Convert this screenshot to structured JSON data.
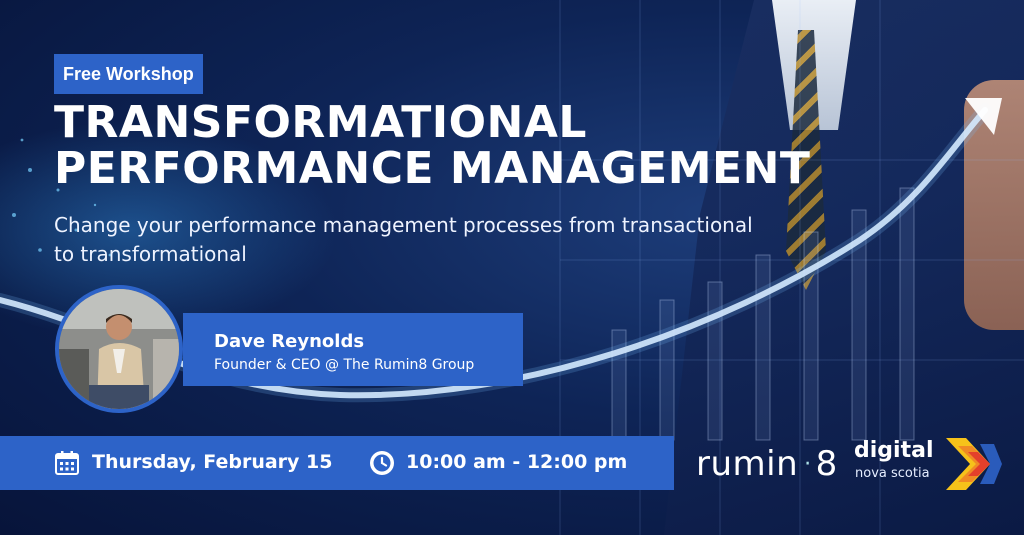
{
  "badge": "Free Workshop",
  "title": {
    "line1": "TRANSFORMATIONAL",
    "line2": "PERFORMANCE MANAGEMENT"
  },
  "subtitle": {
    "line1": "Change your performance management processes from transactional",
    "line2": "to transformational"
  },
  "speaker": {
    "name": "Dave Reynolds",
    "role": "Founder & CEO @ The Rumin8 Group"
  },
  "event": {
    "date": "Thursday, February 15",
    "time": "10:00 am - 12:00 pm",
    "calendar_icon": "calendar-icon",
    "clock_icon": "clock-icon"
  },
  "logos": {
    "rumin8_left": "rumin",
    "rumin8_right": "8",
    "dns_word1": "digital",
    "dns_word2": "nova scotia"
  },
  "colors": {
    "accent": "#2d63c8",
    "background": "#0e2456",
    "dns_yellow": "#f6c21a",
    "dns_red": "#e4402b",
    "dns_orange": "#f08a24"
  }
}
